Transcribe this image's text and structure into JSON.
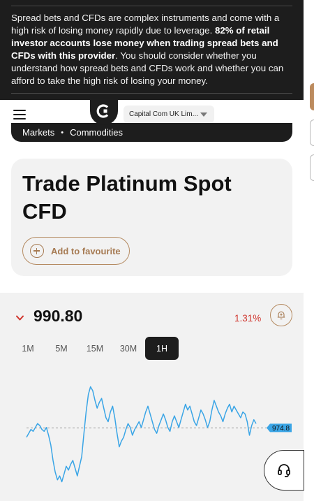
{
  "risk_warning": {
    "part1": "Spread bets and CFDs are complex instruments and come with a high risk of losing money rapidly due to leverage. ",
    "bold": "82% of retail investor accounts lose money when trading spread bets and CFDs with this provider",
    "part2": ". You should consider whether you understand how spread bets and CFDs work and whether you can afford to take the high risk of losing your money."
  },
  "header": {
    "menu_icon": "hamburger-icon",
    "logo_icon": "capital-com-logo",
    "entity_select": "Capital Com UK Lim..."
  },
  "breadcrumb": {
    "items": [
      "Markets",
      "Commodities"
    ],
    "separator": "•"
  },
  "title_card": {
    "title": "Trade Platinum Spot CFD",
    "favourite_label": "Add to favourite"
  },
  "quote": {
    "direction": "down",
    "price": "990.80",
    "change": "1.31%",
    "alert_icon": "bell-plus-icon"
  },
  "timeframes": {
    "items": [
      "1M",
      "5M",
      "15M",
      "30M",
      "1H"
    ],
    "active": "1H"
  },
  "colors": {
    "brand_dark": "#1d1d1d",
    "accent": "#a67a52",
    "negative": "#d0342c",
    "chart_line": "#3aa5e6"
  },
  "chart_data": {
    "type": "line",
    "reference_label": "974.8",
    "series": [
      {
        "values": [
          970,
          972,
          974,
          973,
          975,
          977,
          976,
          974,
          973,
          975,
          971,
          966,
          958,
          952,
          948,
          950,
          947,
          951,
          955,
          953,
          956,
          958,
          954,
          950,
          955,
          960,
          972,
          983,
          992,
          996,
          994,
          989,
          985,
          988,
          990,
          985,
          980,
          978,
          983,
          986,
          980,
          972,
          965,
          968,
          970,
          974,
          977,
          975,
          971,
          974,
          976,
          978,
          975,
          979,
          983,
          986,
          982,
          978,
          974,
          972,
          976,
          979,
          982,
          979,
          975,
          973,
          978,
          981,
          978,
          975,
          979,
          983,
          987,
          984,
          986,
          982,
          978,
          976,
          980,
          984,
          982,
          979,
          975,
          978,
          984,
          989,
          986,
          983,
          981,
          978,
          982,
          985,
          987,
          983,
          986,
          984,
          982,
          980,
          983,
          982,
          978,
          971,
          976,
          979,
          977
        ]
      }
    ]
  },
  "support": {
    "icon": "headset-icon"
  }
}
